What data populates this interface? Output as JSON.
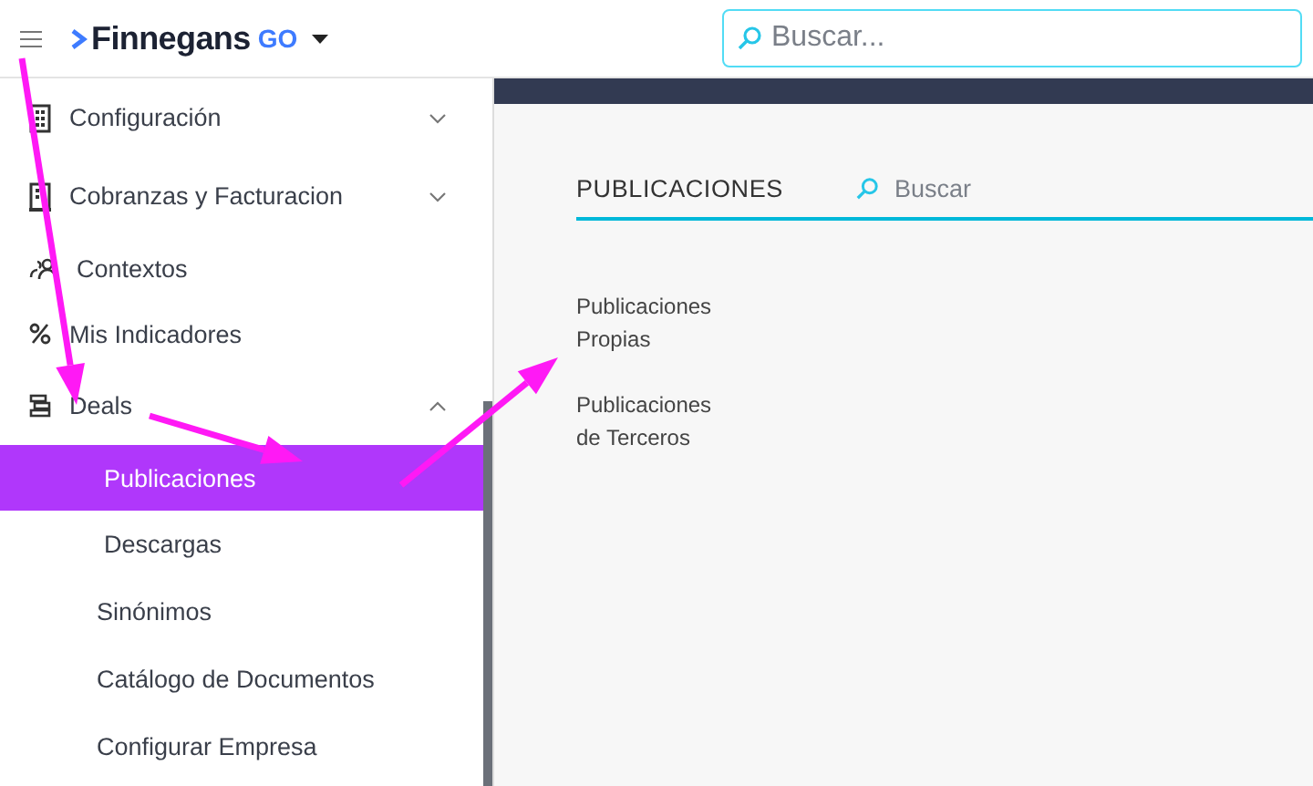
{
  "header": {
    "brand": "Finnegans",
    "brand_suffix": "GO",
    "search": {
      "placeholder": "Buscar..."
    }
  },
  "sidebar": {
    "items": [
      {
        "label": "Configuración",
        "kind": "group",
        "expanded": false
      },
      {
        "label": "Cobranzas y Facturacion",
        "kind": "group",
        "expanded": false
      },
      {
        "label": "Contextos",
        "kind": "link"
      },
      {
        "label": "Mis Indicadores",
        "kind": "link"
      },
      {
        "label": "Deals",
        "kind": "group",
        "expanded": true,
        "children": [
          {
            "label": "Publicaciones",
            "selected": true
          },
          {
            "label": "Descargas",
            "selected": false
          }
        ]
      },
      {
        "label": "Sinónimos",
        "kind": "plain"
      },
      {
        "label": "Catálogo de Documentos",
        "kind": "plain"
      },
      {
        "label": "Configurar Empresa",
        "kind": "plain"
      }
    ]
  },
  "main": {
    "title": "PUBLICACIONES",
    "search": {
      "placeholder": "Buscar"
    },
    "links": [
      {
        "lines": [
          "Publicaciones",
          "Propias"
        ]
      },
      {
        "lines": [
          "Publicaciones",
          "de Terceros"
        ]
      }
    ]
  }
}
